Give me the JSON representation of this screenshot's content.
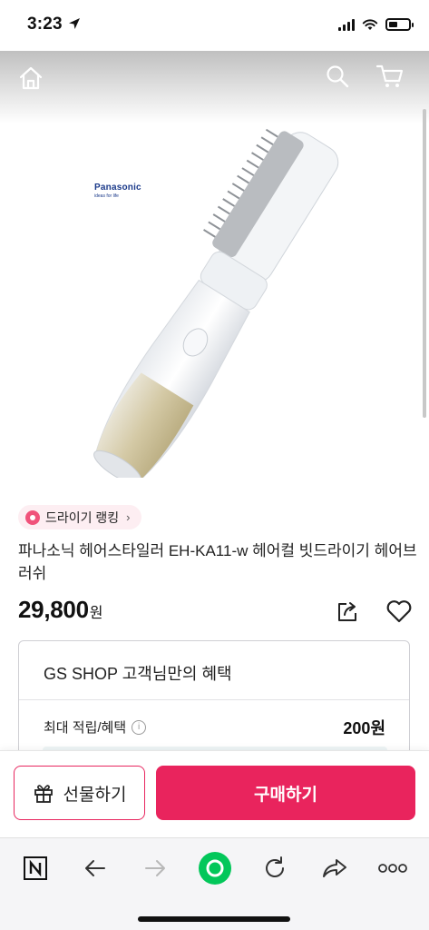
{
  "status_bar": {
    "time": "3:23"
  },
  "hero": {
    "brand_logo": "Panasonic",
    "brand_tagline": "ideas for life"
  },
  "ranking": {
    "label": "드라이기 랭킹"
  },
  "product": {
    "title": "파나소닉 헤어스타일러 EH-KA11-w 헤어컬 빗드라이기 헤어브러쉬",
    "price": "29,800",
    "price_unit": "원"
  },
  "benefit": {
    "title": "GS SHOP 고객님만의 혜택",
    "rows": [
      {
        "label": "최대 적립/혜택",
        "value": "200원"
      }
    ]
  },
  "actions": {
    "gift_label": "선물하기",
    "buy_label": "구매하기"
  },
  "colors": {
    "accent": "#e9245d",
    "chip_bg": "#fdeef2",
    "naver_green": "#03c75a"
  },
  "toolbar_icons": [
    "naver-n-icon",
    "back-arrow-icon",
    "forward-arrow-icon",
    "naver-green-dot-icon",
    "refresh-icon",
    "share-forward-icon",
    "more-dots-icon"
  ]
}
